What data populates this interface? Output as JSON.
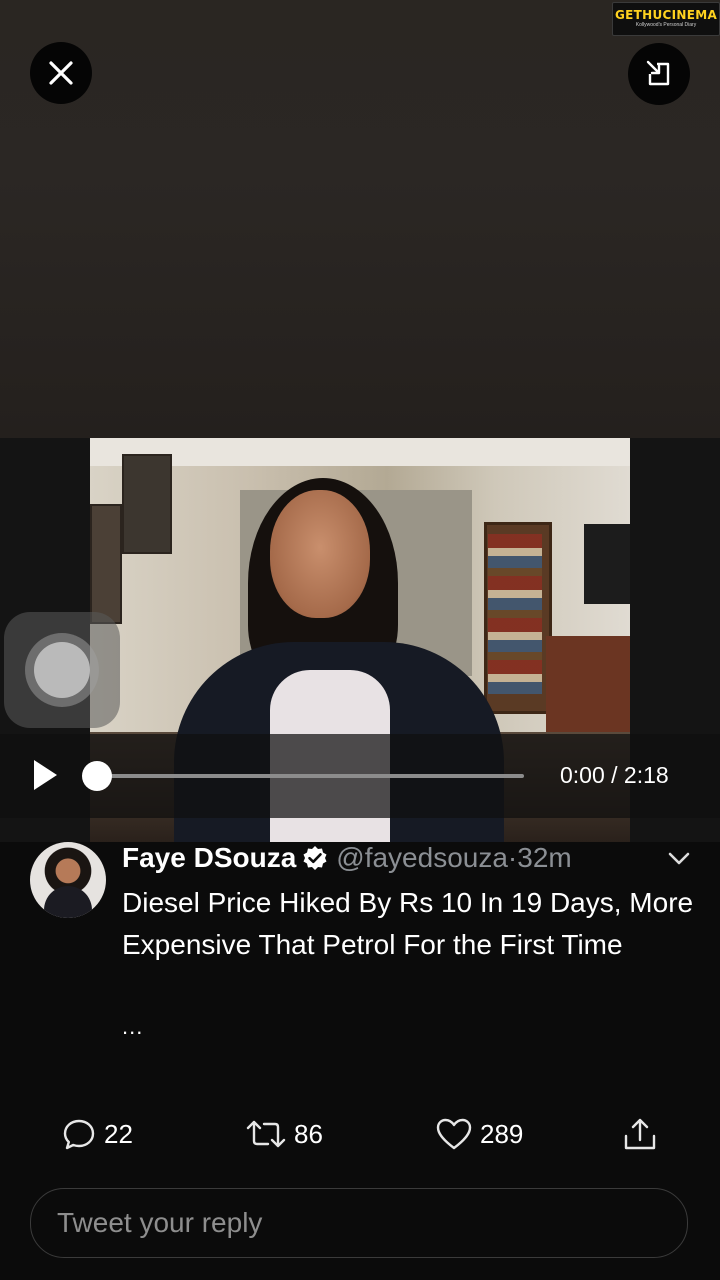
{
  "watermark": {
    "title": "GETHUCINEMA",
    "subtitle": "Kollywood's Personal Diary"
  },
  "player": {
    "current_time": "0:00",
    "duration": "2:18",
    "time_display": "0:00 / 2:18",
    "progress": 0
  },
  "tweet": {
    "author_name": "Faye DSouza",
    "handle_time": "@fayedsouza·32m",
    "verified": true,
    "text": "Diesel Price Hiked By Rs 10 In 19 Days, More Expensive That Petrol For the First Time",
    "ellipsis": "...",
    "replies": "22",
    "retweets": "86",
    "likes": "289"
  },
  "reply": {
    "placeholder": "Tweet your reply"
  },
  "icons": {
    "close": "close-icon",
    "minimize": "minimize-icon",
    "play": "play-icon",
    "verified": "verified-badge-icon",
    "chevron": "chevron-down-icon",
    "reply": "reply-icon",
    "retweet": "retweet-icon",
    "like": "heart-icon",
    "share": "share-icon"
  },
  "colors": {
    "background": "#0b0b0b",
    "handle_gray": "#8b8f94",
    "watermark_yellow": "#ffd21f"
  }
}
